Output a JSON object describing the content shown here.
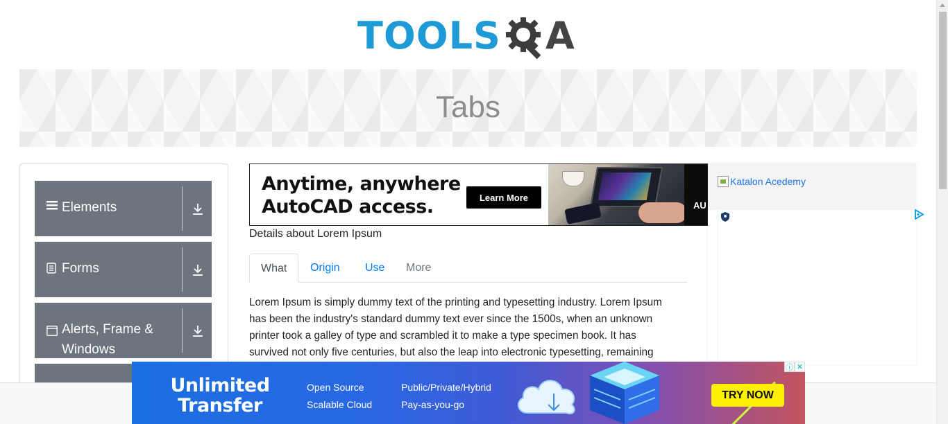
{
  "header": {
    "logo_part1": "TOOLS",
    "logo_part2": "A",
    "logo_icon": "gear-magnifier-icon"
  },
  "banner": {
    "title": "Tabs"
  },
  "sidebar": {
    "groups": [
      {
        "label": "Elements",
        "icon": "hamburger-icon"
      },
      {
        "label": "Forms",
        "icon": "document-icon"
      },
      {
        "label": "Alerts, Frame &",
        "label2": "Windows",
        "icon": "window-icon"
      }
    ]
  },
  "ad_top": {
    "headline_line1": "Anytime, anywhere",
    "headline_line2": "AutoCAD access.",
    "button": "Learn More",
    "fragment": "AU"
  },
  "main": {
    "subtitle": "Details about Lorem Ipsum",
    "tabs": [
      {
        "label": "What",
        "state": "active"
      },
      {
        "label": "Origin",
        "state": "normal"
      },
      {
        "label": "Use",
        "state": "normal"
      },
      {
        "label": "More",
        "state": "disabled"
      }
    ],
    "content_lines": [
      "Lorem Ipsum is simply dummy text of the printing and typesetting industry. Lorem Ipsum",
      "has been the industry's standard dummy text ever since the 1500s, when an unknown",
      "printer took a galley of type and scrambled it to make a type specimen book. It has",
      "survived not only five centuries, but also the leap into electronic typesetting, remaining"
    ]
  },
  "right_ad": {
    "alt_text": "Katalon Acedemy"
  },
  "bottom_ad": {
    "title_line1": "Unlimited",
    "title_line2": "Transfer",
    "features_col1": [
      "Open Source",
      "Scalable Cloud"
    ],
    "features_col2": [
      "Public/Private/Hybrid",
      "Pay-as-you-go"
    ],
    "button": "TRY NOW"
  },
  "colors": {
    "brand_blue": "#1e9ad6",
    "sidebar_gray": "#6c757d",
    "link_blue": "#007bff",
    "ad_yellow": "#ffef00"
  }
}
